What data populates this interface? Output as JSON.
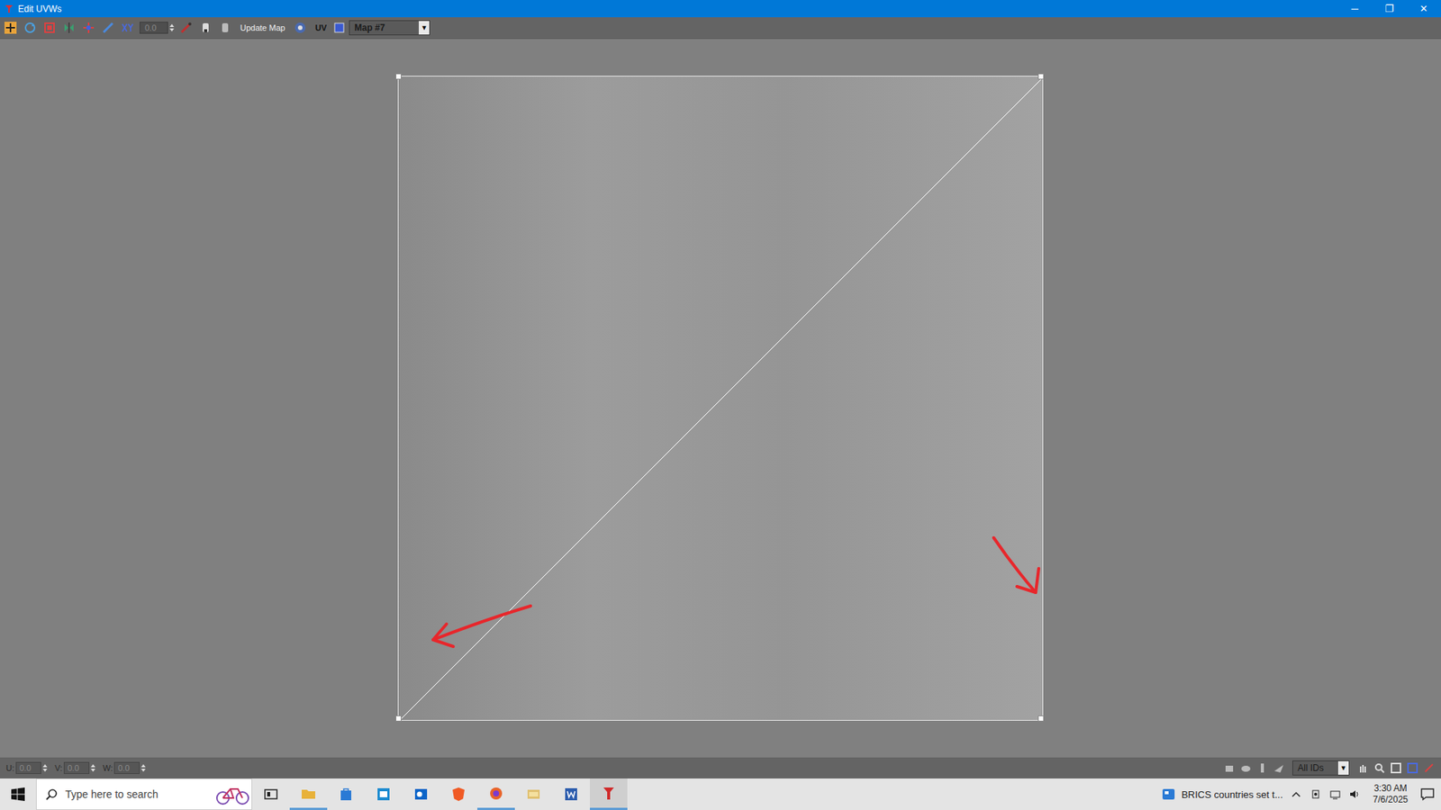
{
  "window": {
    "title": "Edit UVWs",
    "controls": [
      "─",
      "❐",
      "✕"
    ]
  },
  "toolbar": {
    "spinner_value": "0.0",
    "update_map": "Update Map",
    "uv_label": "UV",
    "map_dropdown": {
      "value": "Map #7",
      "arrow": "▼"
    }
  },
  "status_bar": {
    "fields": [
      {
        "label": "U:",
        "value": "0.0"
      },
      {
        "label": "V:",
        "value": "0.0"
      },
      {
        "label": "W:",
        "value": "0.0"
      }
    ],
    "id_filter": {
      "value": "All IDs",
      "arrow": "▼"
    }
  },
  "taskbar": {
    "search_placeholder": "Type here to search",
    "notification": "BRICS countries set t...",
    "time": "3:30 AM",
    "date": "7/6/2025"
  }
}
